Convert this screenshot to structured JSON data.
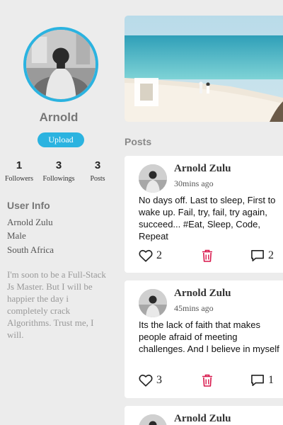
{
  "profile": {
    "name": "Arnold",
    "upload_label": "Upload",
    "stats": [
      {
        "value": "1",
        "label": "Followers"
      },
      {
        "value": "3",
        "label": "Followings"
      },
      {
        "value": "3",
        "label": "Posts"
      }
    ]
  },
  "user_info": {
    "title": "User Info",
    "full_name": "Arnold Zulu",
    "gender": "Male",
    "country": "South Africa",
    "bio": "I'm soon to be a Full-Stack Js Master. But I will be happier the day i completely crack Algorithms. Trust me, I will."
  },
  "posts_heading": "Posts",
  "posts": [
    {
      "author": "Arnold Zulu",
      "time": "30mins ago",
      "text": "No days off. Last to sleep, First to wake up. Fail, try, fail, try again, succeed... #Eat, Sleep, Code, Repeat",
      "likes": "2",
      "comments": "2"
    },
    {
      "author": "Arnold Zulu",
      "time": "45mins ago",
      "text": "Its the lack of faith that makes people afraid of meeting challenges. And I believe in myself",
      "likes": "3",
      "comments": "1"
    },
    {
      "author": "Arnold Zulu"
    }
  ],
  "colors": {
    "accent": "#2bb3e0",
    "delete": "#d8174b",
    "background": "#ececec"
  },
  "icons": {
    "like": "heart-outline-icon",
    "delete": "trash-icon",
    "comment": "speech-bubble-icon"
  }
}
